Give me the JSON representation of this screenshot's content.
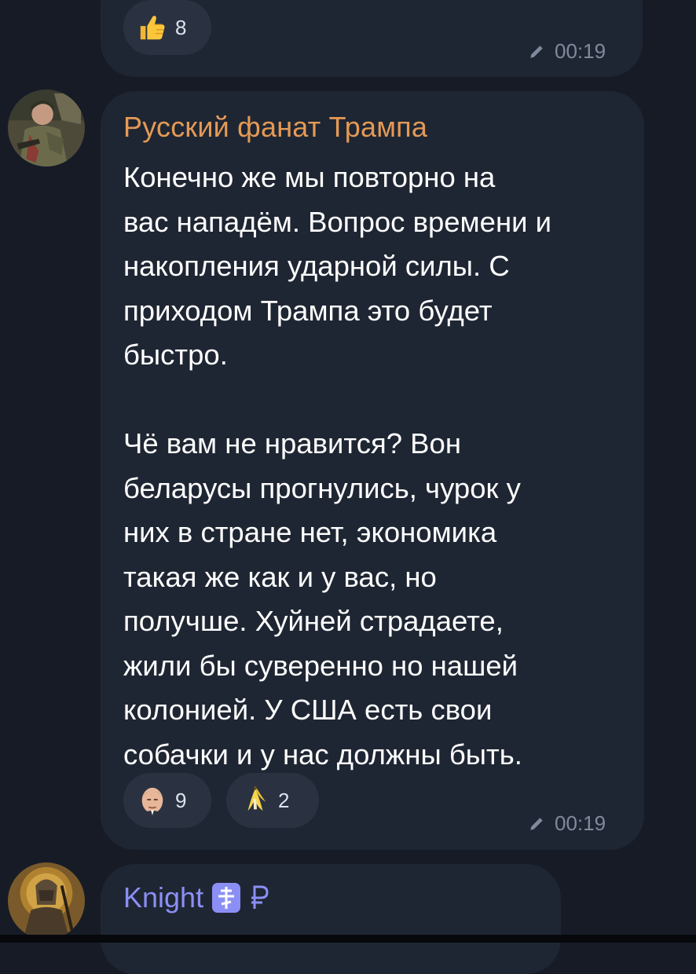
{
  "colors": {
    "background": "#161b26",
    "bubble": "#1f2633",
    "reaction_bg": "#2a3241",
    "sender_orange": "#e49a55",
    "sender_purple": "#8b8ff5",
    "meta_gray": "#7f8a9c",
    "text": "#ffffff"
  },
  "messages": [
    {
      "reactions": [
        {
          "emoji": "thumbs-up",
          "count": "8"
        }
      ],
      "edited_icon": "pencil-icon",
      "time": "00:19"
    },
    {
      "sender": "Русский фанат Трампа",
      "avatar": "soldier-avatar",
      "text": "Конечно же мы повторно на\nвас нападём. Вопрос времени и\nнакопления ударной силы. С\nприходом Трампа это будет\nбыстро.\n\nЧё вам не нравится? Вон\nбеларусы прогнулись, чурок у\nних в стране нет, экономика\nтакая же как и у вас, но\nполучше. Хуйней страдаете,\nжили бы суверенно но нашей\nколонией. У США есть свои\nсобачки и у нас должны быть.",
      "reactions": [
        {
          "emoji": "putin-face",
          "count": "9"
        },
        {
          "emoji": "banana",
          "count": "2"
        }
      ],
      "edited_icon": "pencil-icon",
      "time": "00:19"
    },
    {
      "sender": "Knight",
      "sender_badges": [
        "orthodox-cross-icon",
        "ruble-icon"
      ],
      "avatar": "knight-avatar"
    }
  ]
}
